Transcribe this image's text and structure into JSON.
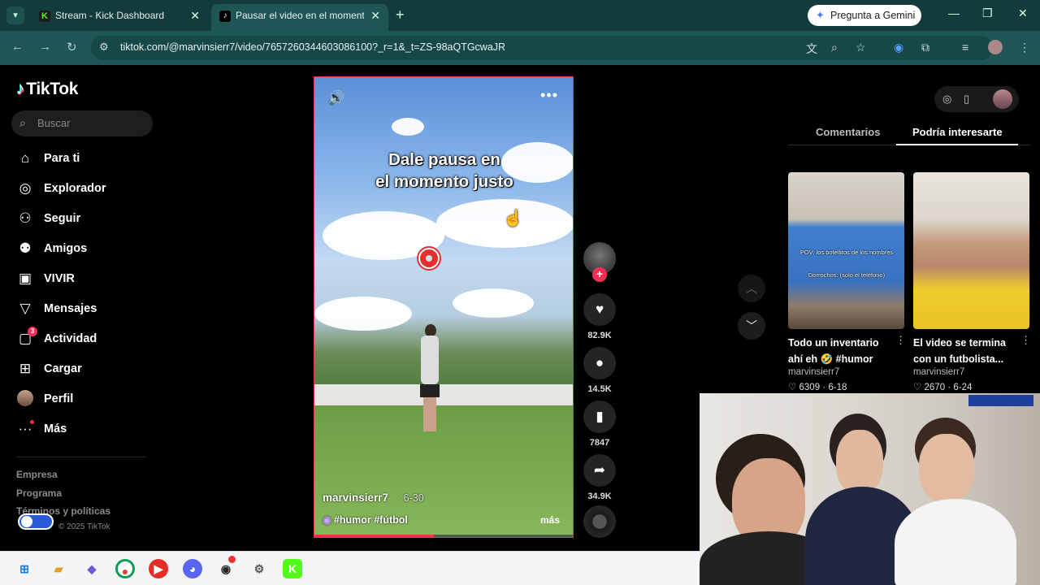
{
  "browser": {
    "tabs": [
      {
        "title": "Stream - Kick Dashboard",
        "favicon": "kick-icon"
      },
      {
        "title": "Pausar el video en el momento",
        "favicon": "tiktok-icon"
      }
    ],
    "gemini_label": "Pregunta a Gemini",
    "url": "tiktok.com/@marvinsierr7/video/7657260344603086100?_r=1&_t=ZS-98aQTGcwaJR"
  },
  "tiktok": {
    "logo": "TikTok",
    "search_placeholder": "Buscar",
    "nav": [
      {
        "label": "Para ti",
        "icon": "home-icon"
      },
      {
        "label": "Explorador",
        "icon": "compass-icon"
      },
      {
        "label": "Seguir",
        "icon": "following-icon"
      },
      {
        "label": "Amigos",
        "icon": "friends-icon"
      },
      {
        "label": "VIVIR",
        "icon": "live-icon"
      },
      {
        "label": "Mensajes",
        "icon": "messages-icon"
      },
      {
        "label": "Actividad",
        "icon": "activity-icon",
        "badge": "3"
      },
      {
        "label": "Cargar",
        "icon": "upload-icon"
      },
      {
        "label": "Perfil",
        "icon": "avatar"
      },
      {
        "label": "Más",
        "icon": "more-icon"
      }
    ],
    "footer": [
      "Empresa",
      "Programa",
      "Términos y políticas"
    ],
    "footer_small": "© 2025 TikTok",
    "video": {
      "caption_overlay_1": "Dale pausa en",
      "caption_overlay_2": "el momento justo",
      "author": "marvinsierr7",
      "date": "· 6-30",
      "tags": "#humor #fútbol",
      "more": "más",
      "progress": 0.46
    },
    "actions": {
      "likes": "82.9K",
      "comments": "14.5K",
      "saves": "7847",
      "shares": "34.9K"
    },
    "right_tabs": {
      "comments": "Comentarios",
      "suggested": "Podría interesarte"
    },
    "suggested": [
      {
        "title": "Todo un inventario ahí eh 🤣 #humor",
        "author": "marvinsierr7",
        "likes": "6309",
        "date": "6-18",
        "thumb_caption": "POV: los botellitos de los nombres",
        "thumb_caption_2": "Dorrochos: (solo el teléfono)"
      },
      {
        "title": "El video se termina con un futbolista...",
        "author": "marvinsierr7",
        "likes": "2670",
        "date": "6-24"
      }
    ]
  },
  "colors": {
    "accent": "#fe2c55",
    "chrome": "#133b3b",
    "chrome_bar": "#1e5656"
  }
}
